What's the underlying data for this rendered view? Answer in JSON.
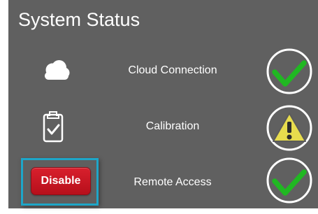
{
  "panel": {
    "title": "System Status"
  },
  "rows": [
    {
      "label": "Cloud Connection",
      "left_icon": "cloud-icon",
      "status": "ok",
      "status_icon": "check-circle-icon"
    },
    {
      "label": "Calibration",
      "left_icon": "clipboard-check-icon",
      "status": "warning",
      "status_icon": "warning-circle-icon"
    },
    {
      "label": "Remote Access",
      "left_control": {
        "label": "Disable"
      },
      "status": "ok",
      "status_icon": "check-circle-icon"
    }
  ],
  "colors": {
    "panel_background": "#606060",
    "text": "#ffffff",
    "ok_check": "#20b822",
    "warning_fill": "#e7dc4d",
    "button_red": "#c81824",
    "focus_outline": "#1ea6c8"
  }
}
